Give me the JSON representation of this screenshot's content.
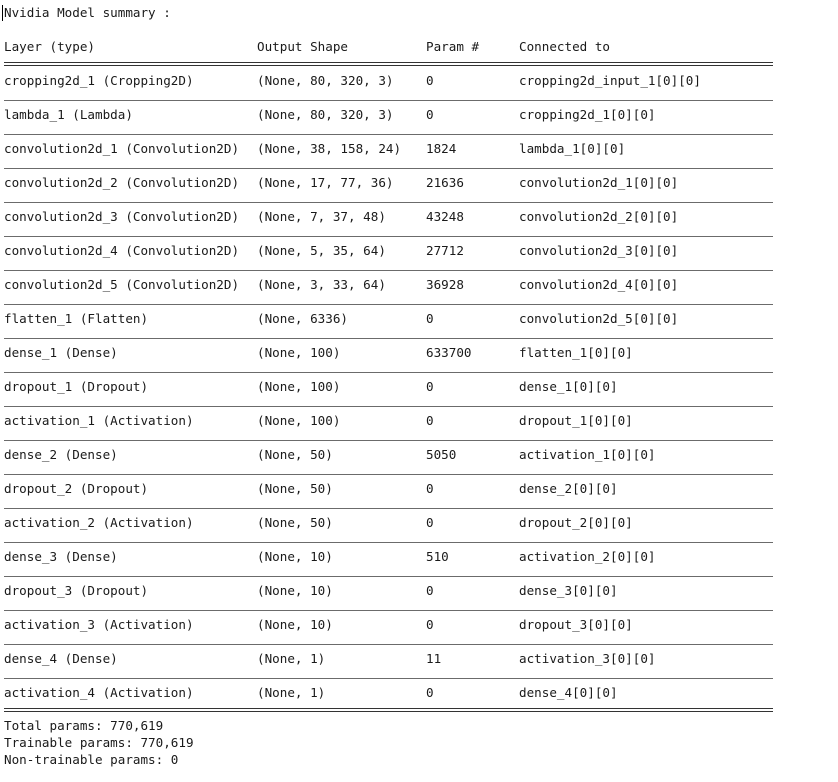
{
  "title": "Nvidia Model summary :",
  "headers": [
    "Layer (type)",
    "Output Shape",
    "Param #",
    "Connected to"
  ],
  "rows": [
    [
      "cropping2d_1 (Cropping2D)",
      "(None, 80, 320, 3)",
      "0",
      "cropping2d_input_1[0][0]"
    ],
    [
      "lambda_1 (Lambda)",
      "(None, 80, 320, 3)",
      "0",
      "cropping2d_1[0][0]"
    ],
    [
      "convolution2d_1 (Convolution2D)",
      "(None, 38, 158, 24)",
      "1824",
      "lambda_1[0][0]"
    ],
    [
      "convolution2d_2 (Convolution2D)",
      "(None, 17, 77, 36)",
      "21636",
      "convolution2d_1[0][0]"
    ],
    [
      "convolution2d_3 (Convolution2D)",
      "(None, 7, 37, 48)",
      "43248",
      "convolution2d_2[0][0]"
    ],
    [
      "convolution2d_4 (Convolution2D)",
      "(None, 5, 35, 64)",
      "27712",
      "convolution2d_3[0][0]"
    ],
    [
      "convolution2d_5 (Convolution2D)",
      "(None, 3, 33, 64)",
      "36928",
      "convolution2d_4[0][0]"
    ],
    [
      "flatten_1 (Flatten)",
      "(None, 6336)",
      "0",
      "convolution2d_5[0][0]"
    ],
    [
      "dense_1 (Dense)",
      "(None, 100)",
      "633700",
      "flatten_1[0][0]"
    ],
    [
      "dropout_1 (Dropout)",
      "(None, 100)",
      "0",
      "dense_1[0][0]"
    ],
    [
      "activation_1 (Activation)",
      "(None, 100)",
      "0",
      "dropout_1[0][0]"
    ],
    [
      "dense_2 (Dense)",
      "(None, 50)",
      "5050",
      "activation_1[0][0]"
    ],
    [
      "dropout_2 (Dropout)",
      "(None, 50)",
      "0",
      "dense_2[0][0]"
    ],
    [
      "activation_2 (Activation)",
      "(None, 50)",
      "0",
      "dropout_2[0][0]"
    ],
    [
      "dense_3 (Dense)",
      "(None, 10)",
      "510",
      "activation_2[0][0]"
    ],
    [
      "dropout_3 (Dropout)",
      "(None, 10)",
      "0",
      "dense_3[0][0]"
    ],
    [
      "activation_3 (Activation)",
      "(None, 10)",
      "0",
      "dropout_3[0][0]"
    ],
    [
      "dense_4 (Dense)",
      "(None, 1)",
      "11",
      "activation_3[0][0]"
    ],
    [
      "activation_4 (Activation)",
      "(None, 1)",
      "0",
      "dense_4[0][0]"
    ]
  ],
  "totals": {
    "total": "Total params: 770,619",
    "trainable": "Trainable params: 770,619",
    "non_trainable": "Non-trainable params: 0"
  }
}
